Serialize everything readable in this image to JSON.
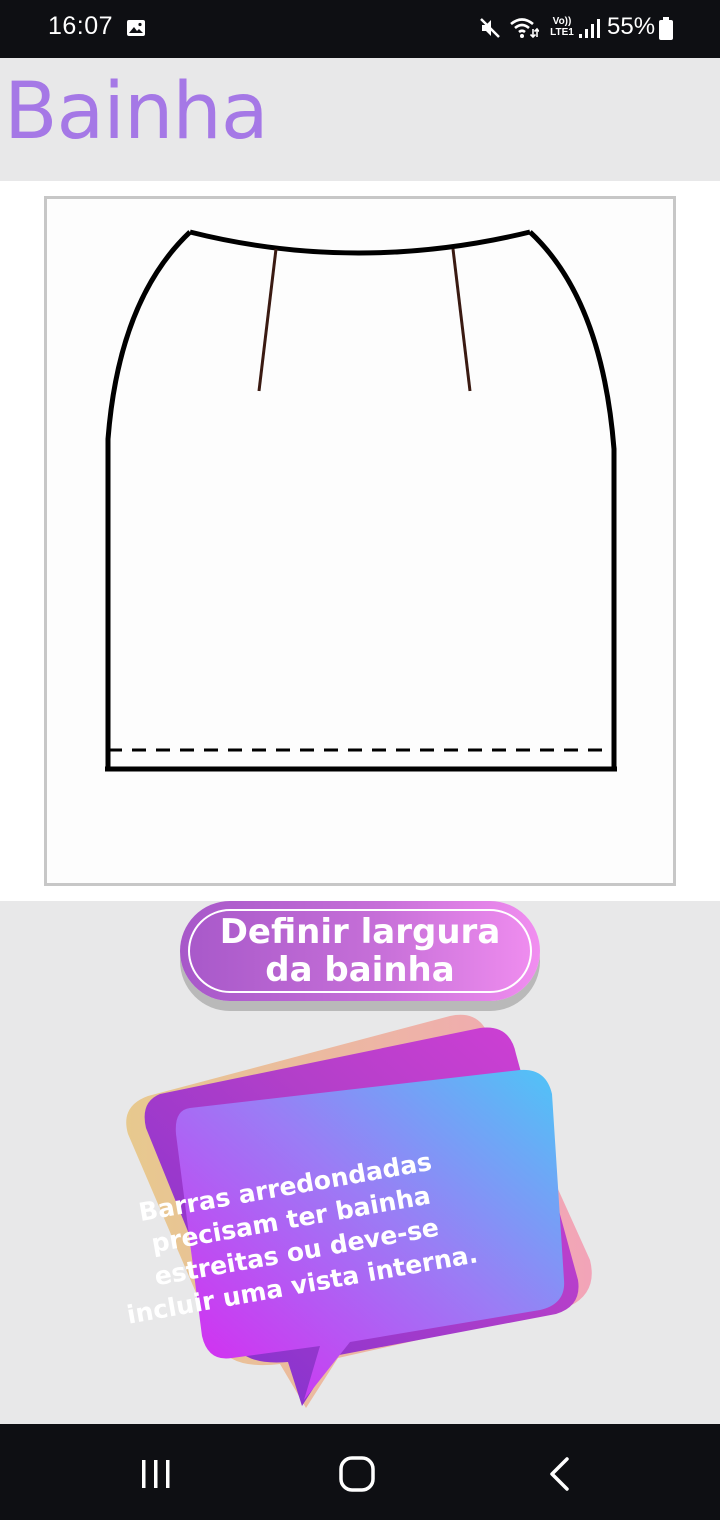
{
  "status_bar": {
    "time": "16:07",
    "lte_label": "Vo))\nLTE1",
    "battery_percent": "55%",
    "icons": [
      "gallery-icon",
      "mute-icon",
      "wifi-icon",
      "signal-icon",
      "battery-icon"
    ]
  },
  "header": {
    "title": "Bainha"
  },
  "illustration": {
    "subject": "skirt-outline-with-hem-line"
  },
  "hem_button": {
    "label": "Definir largura\nda bainha"
  },
  "tip_bubble": {
    "text": "Barras arredondadas precisam ter bainha estreitas ou deve-se incluir uma vista interna."
  },
  "nav_bar": {
    "icons": [
      "recent-apps-icon",
      "home-icon",
      "back-icon"
    ]
  },
  "colors": {
    "title": "#a578e6",
    "background": "#e8e8e9",
    "system_bar": "#0e0f13",
    "button_gradient_start": "#a758c9",
    "button_gradient_end": "#f18ef0",
    "bubble_gradient_start": "#dd22f0",
    "bubble_gradient_end": "#4dc6f7"
  }
}
